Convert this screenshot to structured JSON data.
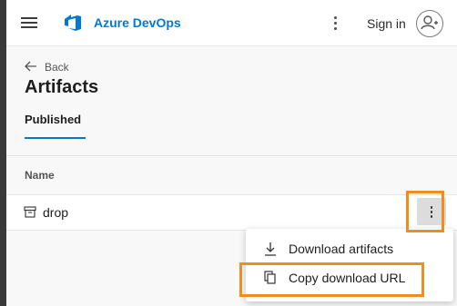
{
  "header": {
    "brand": "Azure DevOps",
    "signin_label": "Sign in",
    "brand_color": "#0078d4"
  },
  "nav": {
    "back_label": "Back"
  },
  "page": {
    "title": "Artifacts",
    "active_tab": "Published"
  },
  "table": {
    "column_header": "Name",
    "rows": [
      {
        "name": "drop",
        "icon": "artifact-package-icon"
      }
    ]
  },
  "context_menu": {
    "items": [
      {
        "label": "Download artifacts",
        "icon": "download-icon"
      },
      {
        "label": "Copy download URL",
        "icon": "copy-icon"
      }
    ]
  },
  "highlight_color": "#f18c21"
}
